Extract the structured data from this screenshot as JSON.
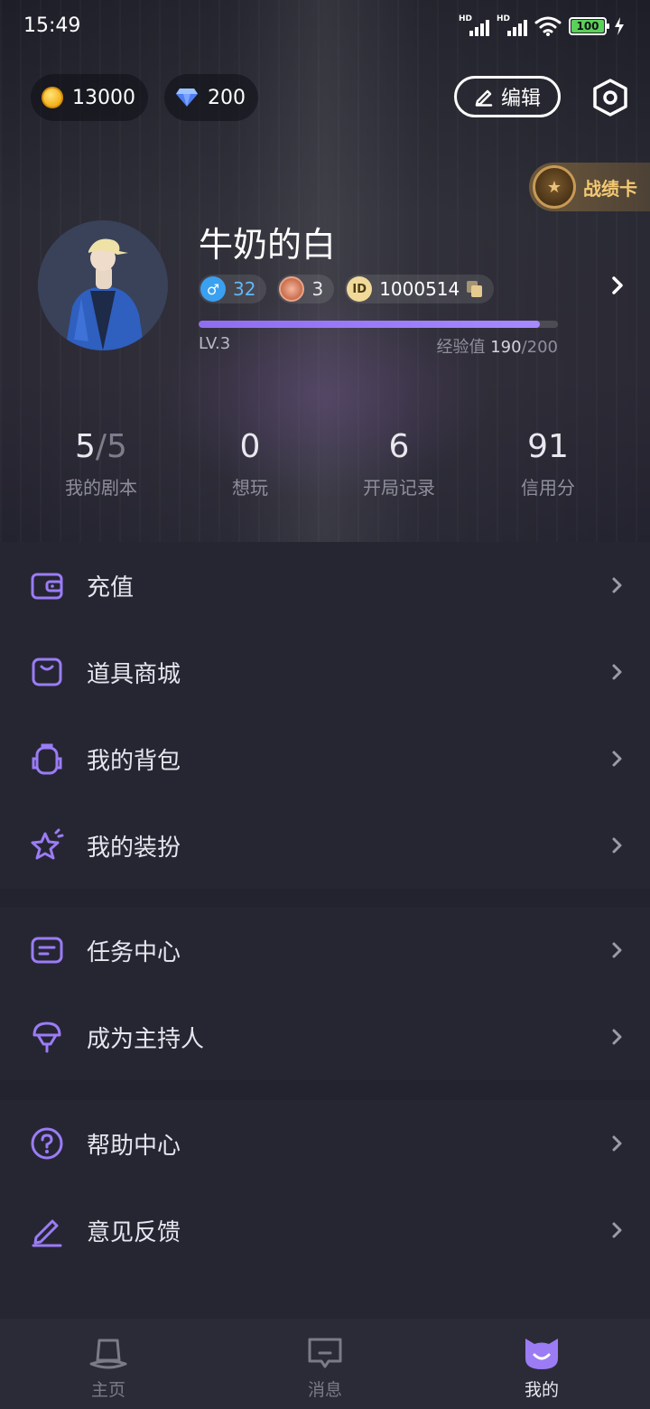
{
  "status_bar": {
    "time": "15:49",
    "signal_1_label": "HD",
    "signal_2_label": "HD",
    "battery_level": "100"
  },
  "wallet": {
    "coins": "13000",
    "diamonds": "200"
  },
  "header": {
    "edit_label": "编辑",
    "record_card_label": "战绩卡"
  },
  "profile": {
    "nickname": "牛奶的白",
    "gender_value": "32",
    "medal_count": "3",
    "id_badge": "ID",
    "user_id": "1000514",
    "level": "LV.3",
    "exp_label": "经验值",
    "exp_current": "190",
    "exp_max": "/200",
    "exp_progress": 0.95
  },
  "stats": [
    {
      "value": "5",
      "value_suffix": "/5",
      "label": "我的剧本"
    },
    {
      "value": "0",
      "label": "想玩"
    },
    {
      "value": "6",
      "label": "开局记录"
    },
    {
      "value": "91",
      "label": "信用分"
    }
  ],
  "menu_sections": [
    [
      {
        "label": "充值",
        "icon": "wallet-icon"
      },
      {
        "label": "道具商城",
        "icon": "shopping-bag-icon"
      },
      {
        "label": "我的背包",
        "icon": "backpack-icon"
      },
      {
        "label": "我的装扮",
        "icon": "star-icon"
      }
    ],
    [
      {
        "label": "任务中心",
        "icon": "task-icon"
      },
      {
        "label": "成为主持人",
        "icon": "host-icon"
      }
    ],
    [
      {
        "label": "帮助中心",
        "icon": "help-icon"
      },
      {
        "label": "意见反馈",
        "icon": "feedback-icon"
      }
    ]
  ],
  "tabs": [
    {
      "label": "主页",
      "icon": "hat-icon"
    },
    {
      "label": "消息",
      "icon": "message-icon"
    },
    {
      "label": "我的",
      "icon": "mascot-icon"
    }
  ],
  "colors": {
    "accent": "#9b7cf5",
    "background": "#23232f",
    "panel": "#262633",
    "tab_bar": "#2b2b38"
  }
}
